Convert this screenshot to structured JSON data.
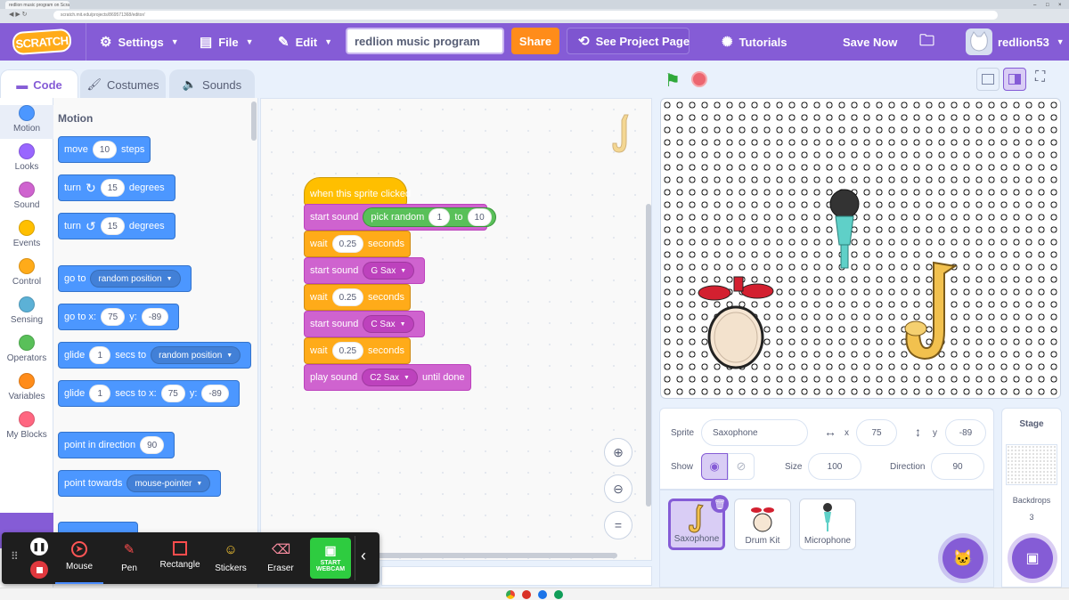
{
  "browser": {
    "tab_title": "redlion music program on Scratch",
    "url": "scratch.mit.edu/projects/869571368/editor/"
  },
  "menubar": {
    "logo": "SCRATCH",
    "settings": "Settings",
    "file": "File",
    "edit": "Edit",
    "project_title": "redlion music program",
    "share": "Share",
    "see_project": "See Project Page",
    "tutorials": "Tutorials",
    "save_now": "Save Now",
    "username": "redlion53"
  },
  "tabs": {
    "code": "Code",
    "costumes": "Costumes",
    "sounds": "Sounds"
  },
  "categories": [
    {
      "label": "Motion",
      "color": "#4c97ff"
    },
    {
      "label": "Looks",
      "color": "#9966ff"
    },
    {
      "label": "Sound",
      "color": "#cf63cf"
    },
    {
      "label": "Events",
      "color": "#ffbf00"
    },
    {
      "label": "Control",
      "color": "#ffab19"
    },
    {
      "label": "Sensing",
      "color": "#5cb1d6"
    },
    {
      "label": "Operators",
      "color": "#59c059"
    },
    {
      "label": "Variables",
      "color": "#ff8c1a"
    },
    {
      "label": "My Blocks",
      "color": "#ff6680"
    }
  ],
  "palette": {
    "heading": "Motion",
    "move": {
      "a": "move",
      "v": "10",
      "b": "steps"
    },
    "turn_right": {
      "a": "turn",
      "v": "15",
      "b": "degrees"
    },
    "turn_left": {
      "a": "turn",
      "v": "15",
      "b": "degrees"
    },
    "go_to": {
      "a": "go to",
      "dd": "random position"
    },
    "go_to_xy": {
      "a": "go to x:",
      "x": "75",
      "yl": "y:",
      "y": "-89"
    },
    "glide": {
      "a": "glide",
      "v": "1",
      "b": "secs to",
      "dd": "random position"
    },
    "glide_xy": {
      "a": "glide",
      "v": "1",
      "b": "secs to x:",
      "x": "75",
      "yl": "y:",
      "y": "-89"
    },
    "point_dir": {
      "a": "point in direction",
      "v": "90"
    },
    "point_towards": {
      "a": "point towards",
      "dd": "mouse-pointer"
    }
  },
  "script": {
    "hat": "when this sprite clicked",
    "start_sound_1": "start sound",
    "pick_random": "pick random",
    "rand_from": "1",
    "rand_to_label": "to",
    "rand_to": "10",
    "wait_1": "wait",
    "wait_1_v": "0.25",
    "wait_unit": "seconds",
    "start_sound_2": "start sound",
    "sound_2": "G Sax",
    "wait_2": "wait",
    "wait_2_v": "0.25",
    "start_sound_3": "start sound",
    "sound_3": "C Sax",
    "wait_3": "wait",
    "wait_3_v": "0.25",
    "play_sound": "play sound",
    "sound_4": "C2 Sax",
    "until_done": "until done"
  },
  "sprite_info": {
    "sprite_label": "Sprite",
    "sprite_name": "Saxophone",
    "x_label": "x",
    "x": "75",
    "y_label": "y",
    "y": "-89",
    "show_label": "Show",
    "size_label": "Size",
    "size": "100",
    "direction_label": "Direction",
    "direction": "90"
  },
  "sprites": [
    {
      "name": "Saxophone",
      "selected": true
    },
    {
      "name": "Drum Kit",
      "selected": false
    },
    {
      "name": "Microphone",
      "selected": false
    }
  ],
  "stage_pane": {
    "title": "Stage",
    "backdrops_label": "Backdrops",
    "backdrops_count": "3"
  },
  "recorder": {
    "mouse": "Mouse",
    "pen": "Pen",
    "rectangle": "Rectangle",
    "stickers": "Stickers",
    "eraser": "Eraser",
    "webcam": "START WEBCAM"
  },
  "colors": {
    "menubar": "#855cd6",
    "motion": "#4c97ff",
    "events": "#ffbf00",
    "sound": "#cf63cf",
    "control": "#ffab19"
  }
}
